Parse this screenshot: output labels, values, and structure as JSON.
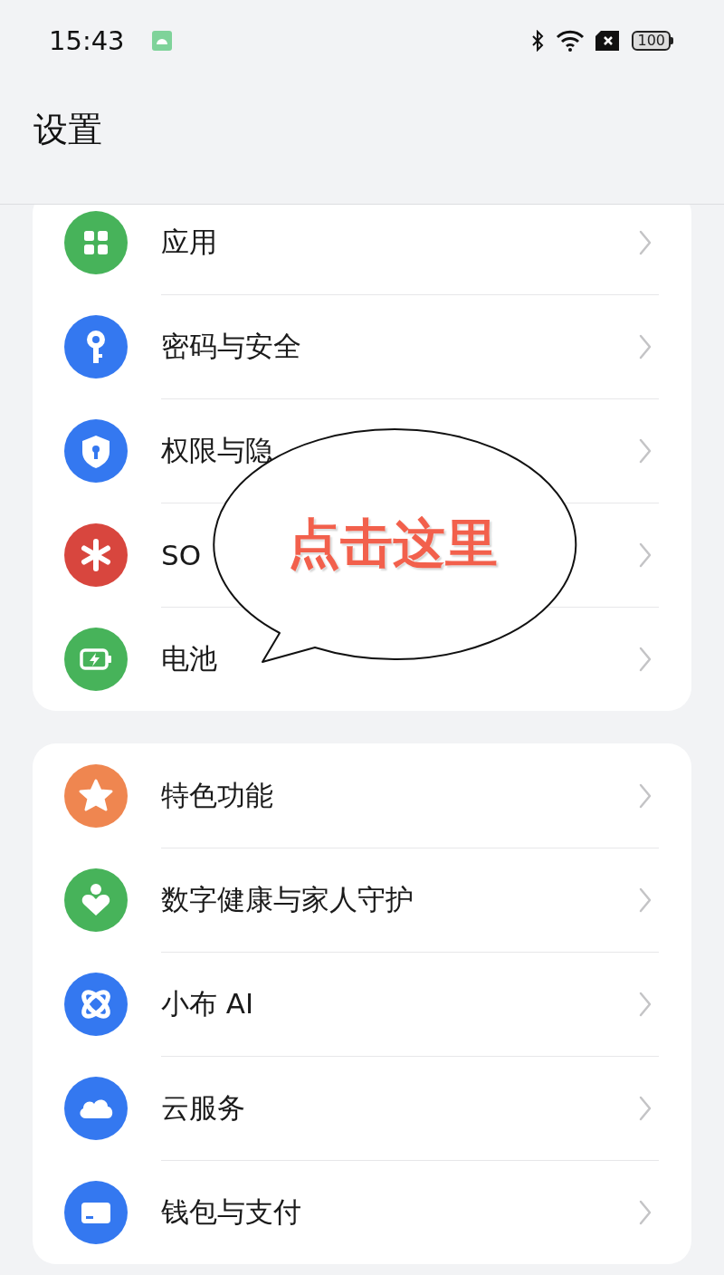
{
  "status_bar": {
    "time": "15:43",
    "battery": "100"
  },
  "header": {
    "title": "设置"
  },
  "groups": [
    {
      "items": [
        {
          "label": "应用",
          "kind": "apps",
          "color": "#47b35a"
        },
        {
          "label": "密码与安全",
          "kind": "key",
          "color": "#3478f0"
        },
        {
          "label": "权限与隐",
          "kind": "shield",
          "color": "#3478f0"
        },
        {
          "label": "SO",
          "kind": "sos",
          "color": "#d8463e"
        },
        {
          "label": "电池",
          "kind": "battery",
          "color": "#47b35a"
        }
      ]
    },
    {
      "items": [
        {
          "label": "特色功能",
          "kind": "star",
          "color": "#ef8650"
        },
        {
          "label": "数字健康与家人守护",
          "kind": "wellbeing",
          "color": "#47b35a"
        },
        {
          "label": "小布 AI",
          "kind": "orbit",
          "color": "#3478f0"
        },
        {
          "label": "云服务",
          "kind": "cloud",
          "color": "#3478f0"
        },
        {
          "label": "钱包与支付",
          "kind": "card",
          "color": "#3478f0"
        }
      ]
    }
  ],
  "callout": {
    "text": "点击这里"
  }
}
